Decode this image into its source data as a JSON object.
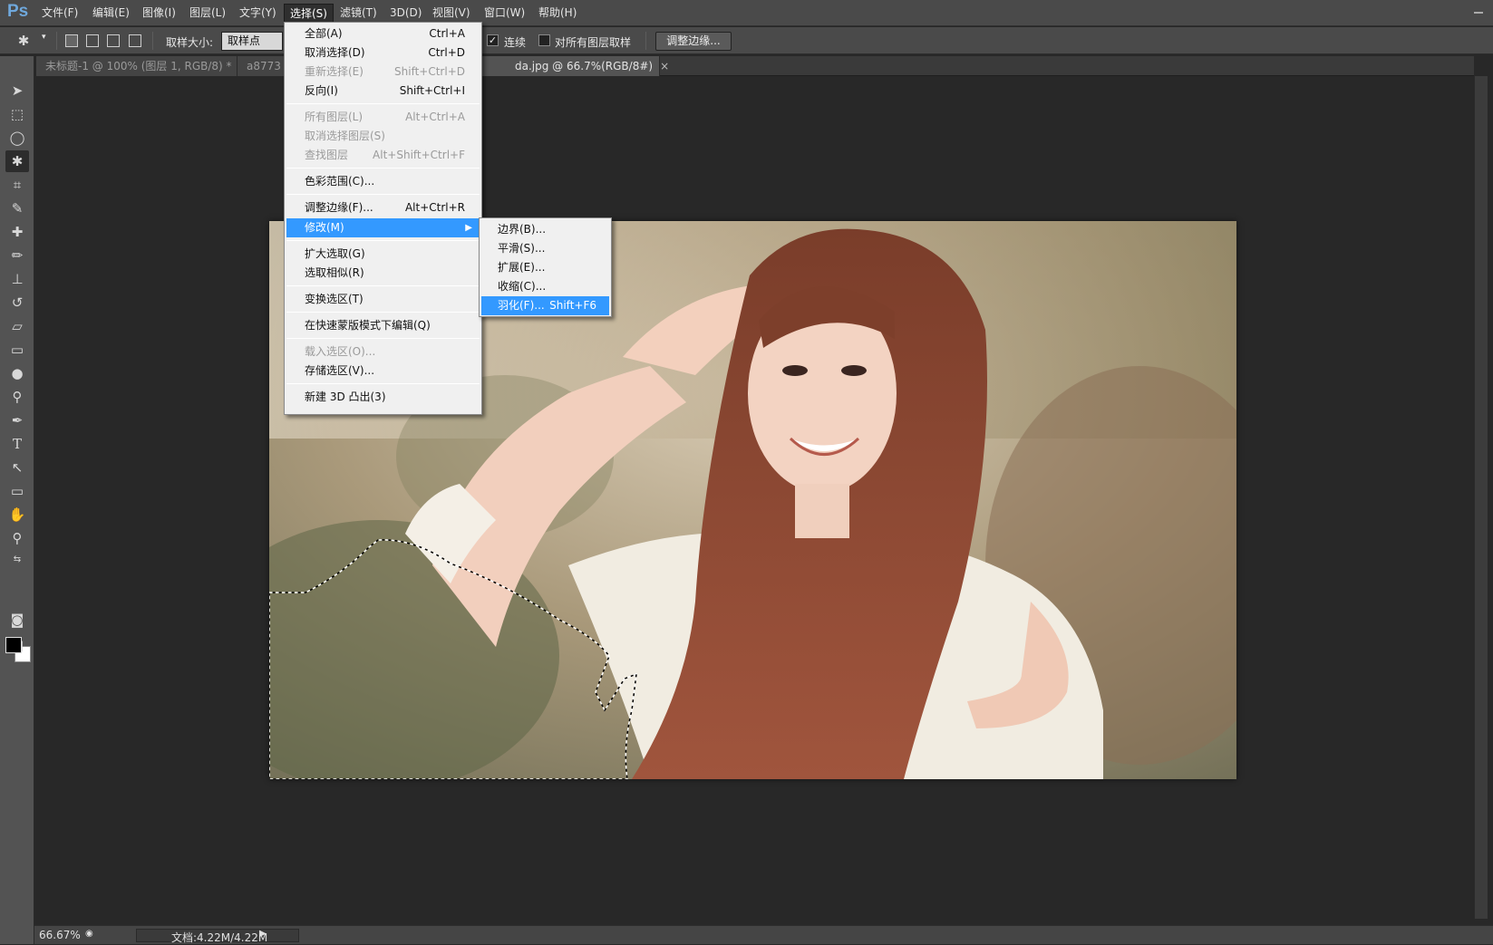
{
  "app": {
    "logo": "Ps"
  },
  "menubar": {
    "items": [
      "文件(F)",
      "编辑(E)",
      "图像(I)",
      "图层(L)",
      "文字(Y)",
      "选择(S)",
      "滤镜(T)",
      "3D(D)",
      "视图(V)",
      "窗口(W)",
      "帮助(H)"
    ],
    "active_index": 5
  },
  "options": {
    "sample_size_label": "取样大小:",
    "sample_size_value": "取样点",
    "contiguous_label": "连续",
    "contiguous_checked": true,
    "sample_all_layers_label": "对所有图层取样",
    "sample_all_layers_checked": false,
    "refine_edge_button": "调整边缘..."
  },
  "tabs": [
    {
      "label": "未标题-1 @ 100% (图层 1, RGB/8) *",
      "close": "×"
    },
    {
      "label": "a8773",
      "close": ""
    },
    {
      "label": "da.jpg @ 66.7%(RGB/8#)",
      "close": "×"
    }
  ],
  "select_menu": {
    "items": [
      {
        "label": "全部(A)",
        "shortcut": "Ctrl+A",
        "disabled": false
      },
      {
        "label": "取消选择(D)",
        "shortcut": "Ctrl+D",
        "disabled": false
      },
      {
        "label": "重新选择(E)",
        "shortcut": "Shift+Ctrl+D",
        "disabled": true
      },
      {
        "label": "反向(I)",
        "shortcut": "Shift+Ctrl+I",
        "disabled": false
      },
      {
        "label": "所有图层(L)",
        "shortcut": "Alt+Ctrl+A",
        "disabled": true
      },
      {
        "label": "取消选择图层(S)",
        "shortcut": "",
        "disabled": true
      },
      {
        "label": "查找图层",
        "shortcut": "Alt+Shift+Ctrl+F",
        "disabled": true
      },
      {
        "label": "色彩范围(C)...",
        "shortcut": "",
        "disabled": false
      },
      {
        "label": "调整边缘(F)...",
        "shortcut": "Alt+Ctrl+R",
        "disabled": false
      },
      {
        "label": "修改(M)",
        "shortcut": "",
        "disabled": false,
        "highlight": true,
        "submenu": true
      },
      {
        "label": "扩大选取(G)",
        "shortcut": "",
        "disabled": false
      },
      {
        "label": "选取相似(R)",
        "shortcut": "",
        "disabled": false
      },
      {
        "label": "变换选区(T)",
        "shortcut": "",
        "disabled": false
      },
      {
        "label": "在快速蒙版模式下编辑(Q)",
        "shortcut": "",
        "disabled": false
      },
      {
        "label": "载入选区(O)...",
        "shortcut": "",
        "disabled": true
      },
      {
        "label": "存储选区(V)...",
        "shortcut": "",
        "disabled": false
      },
      {
        "label": "新建 3D 凸出(3)",
        "shortcut": "",
        "disabled": false
      }
    ]
  },
  "modify_submenu": {
    "items": [
      {
        "label": "边界(B)...",
        "shortcut": ""
      },
      {
        "label": "平滑(S)...",
        "shortcut": ""
      },
      {
        "label": "扩展(E)...",
        "shortcut": ""
      },
      {
        "label": "收缩(C)...",
        "shortcut": ""
      },
      {
        "label": "羽化(F)...",
        "shortcut": "Shift+F6",
        "highlight": true
      }
    ]
  },
  "status": {
    "zoom": "66.67%",
    "doc_size": "文档:4.22M/4.22M"
  }
}
